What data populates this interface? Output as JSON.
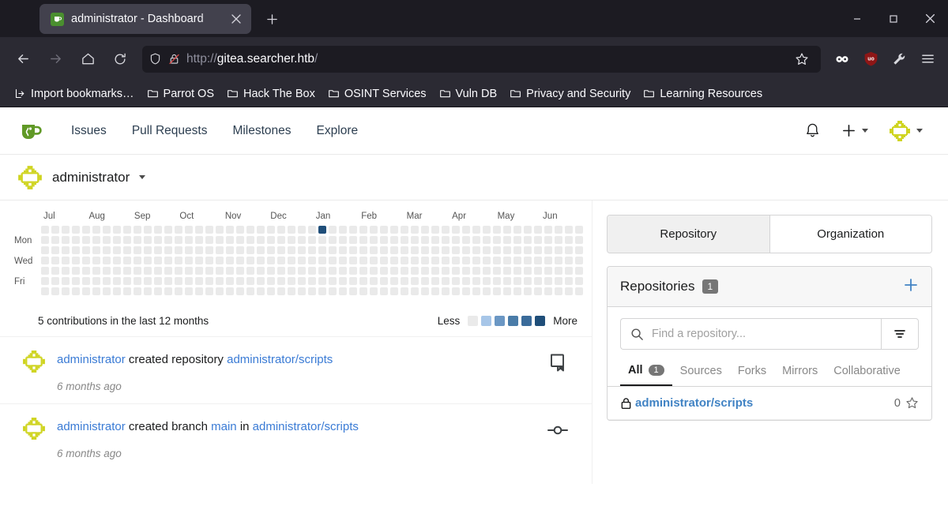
{
  "browser": {
    "tab": {
      "title": "administrator - Dashboard",
      "favicon_icon": "gitea-favicon",
      "close_icon": "close-icon"
    },
    "new_tab_label": "+",
    "window_controls": {
      "minimize": "minimize-icon",
      "maximize": "maximize-icon",
      "close": "close-icon"
    },
    "nav": {
      "back": "back-arrow-icon",
      "forward": "forward-arrow-icon",
      "home": "home-icon",
      "reload": "reload-icon"
    },
    "url": {
      "scheme": "http://",
      "host": "gitea.searcher.htb",
      "path": "/",
      "full": "http://gitea.searcher.htb/",
      "shield_icon": "shield-icon",
      "lock_icon": "lock-crossed-icon"
    },
    "bookmark_star_icon": "star-outline-icon",
    "extensions": [
      {
        "name": "infinity-extension-icon",
        "color": "#ffffff"
      },
      {
        "name": "ublock-origin-icon",
        "color": "#a01717"
      },
      {
        "name": "wrench-tools-icon",
        "color": "#d8d8de"
      }
    ],
    "menu_icon": "hamburger-menu-icon",
    "bookmarks": [
      {
        "label": "Import bookmarks…",
        "icon": "import-icon"
      },
      {
        "label": "Parrot OS",
        "icon": "folder-icon"
      },
      {
        "label": "Hack The Box",
        "icon": "folder-icon"
      },
      {
        "label": "OSINT Services",
        "icon": "folder-icon"
      },
      {
        "label": "Vuln DB",
        "icon": "folder-icon"
      },
      {
        "label": "Privacy and Security",
        "icon": "folder-icon"
      },
      {
        "label": "Learning Resources",
        "icon": "folder-icon"
      }
    ]
  },
  "gitea": {
    "logo_icon": "gitea-teacup-logo",
    "nav": [
      {
        "label": "Issues",
        "name": "nav-issues"
      },
      {
        "label": "Pull Requests",
        "name": "nav-pull-requests"
      },
      {
        "label": "Milestones",
        "name": "nav-milestones"
      },
      {
        "label": "Explore",
        "name": "nav-explore"
      }
    ],
    "header_right": {
      "bell_icon": "bell-icon",
      "plus_icon": "plus-icon",
      "avatar_icon": "user-avatar-identicon"
    },
    "subheader": {
      "username": "administrator",
      "avatar_icon": "user-avatar-identicon",
      "caret_icon": "chevron-down-icon"
    },
    "heatmap": {
      "months": [
        "Jul",
        "Aug",
        "Sep",
        "Oct",
        "Nov",
        "Dec",
        "Jan",
        "Feb",
        "Mar",
        "Apr",
        "May",
        "Jun"
      ],
      "day_labels": [
        "Mon",
        "Wed",
        "Fri"
      ],
      "summary": "5 contributions in the last 12 months",
      "legend_less": "Less",
      "legend_more": "More",
      "legend_colors": [
        "#eaeaea",
        "#a7c6e8",
        "#6b97c4",
        "#4a7ca8",
        "#3a6b9a",
        "#1f4e79"
      ],
      "empty_color": "#eaeaea",
      "active_cell": {
        "week_index": 27,
        "day_index": 0,
        "level": 5,
        "color": "#1f4e79",
        "count": 5
      },
      "weeks": 53,
      "days": 7
    },
    "activity": [
      {
        "actor": "administrator",
        "verb": "created repository",
        "target": "administrator/scripts",
        "time": "6 months ago",
        "icon": "repo-icon",
        "avatar_icon": "user-avatar-identicon"
      },
      {
        "actor": "administrator",
        "verb": "created branch",
        "branch": "main",
        "in_word": "in",
        "target": "administrator/scripts",
        "time": "6 months ago",
        "icon": "git-commit-icon",
        "avatar_icon": "user-avatar-identicon"
      }
    ],
    "sidebar": {
      "tabs": [
        {
          "label": "Repository",
          "active": true
        },
        {
          "label": "Organization",
          "active": false
        }
      ],
      "panel": {
        "title": "Repositories",
        "count": "1",
        "add_icon": "plus-icon",
        "search_placeholder": "Find a repository...",
        "search_value": "",
        "search_icon": "search-icon",
        "filter_icon": "filter-sort-icon",
        "filters": [
          {
            "label": "All",
            "badge": "1",
            "active": true
          },
          {
            "label": "Sources",
            "badge": "",
            "active": false
          },
          {
            "label": "Forks",
            "badge": "",
            "active": false
          },
          {
            "label": "Mirrors",
            "badge": "",
            "active": false
          },
          {
            "label": "Collaborative",
            "badge": "",
            "active": false
          }
        ],
        "repos": [
          {
            "name": "administrator/scripts",
            "private": true,
            "lock_icon": "lock-icon",
            "stars": "0",
            "star_icon": "star-outline-icon"
          }
        ]
      }
    }
  }
}
